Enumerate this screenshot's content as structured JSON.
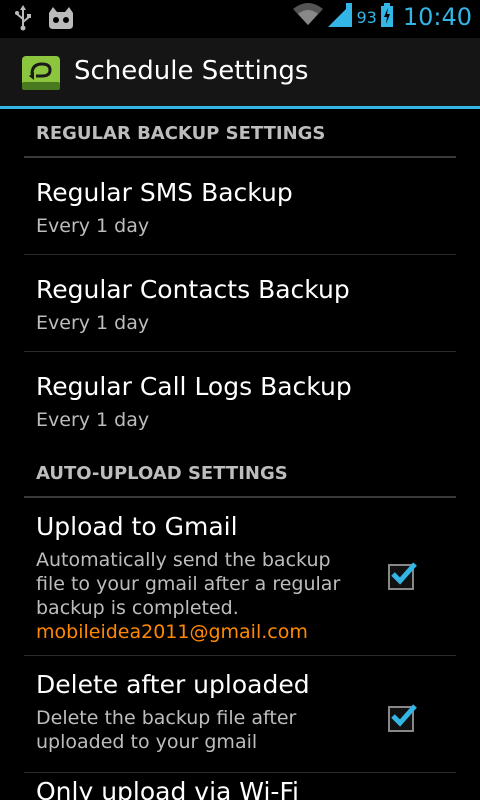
{
  "status_bar": {
    "battery_percent": "93",
    "time": "10:40"
  },
  "action_bar": {
    "title": "Schedule Settings"
  },
  "sections": {
    "regular_backup": {
      "header": "REGULAR BACKUP SETTINGS",
      "items": [
        {
          "title": "Regular SMS Backup",
          "summary": "Every 1 day"
        },
        {
          "title": "Regular Contacts Backup",
          "summary": "Every 1 day"
        },
        {
          "title": "Regular Call Logs Backup",
          "summary": "Every 1 day"
        }
      ]
    },
    "auto_upload": {
      "header": "AUTO-UPLOAD SETTINGS",
      "items": [
        {
          "title": "Upload to Gmail",
          "summary_line1": "Automatically send the backup",
          "summary_line2": "file to your gmail after a regular",
          "summary_line3": "backup is completed.",
          "email": "mobileidea2011@gmail.com",
          "checked": true
        },
        {
          "title": "Delete after uploaded",
          "summary_line1": "Delete the backup file after",
          "summary_line2": "uploaded to your gmail",
          "checked": true
        },
        {
          "title": "Only upload via Wi-Fi"
        }
      ]
    }
  },
  "colors": {
    "accent": "#33b5e5",
    "email": "#ff8800",
    "background": "#000000"
  }
}
